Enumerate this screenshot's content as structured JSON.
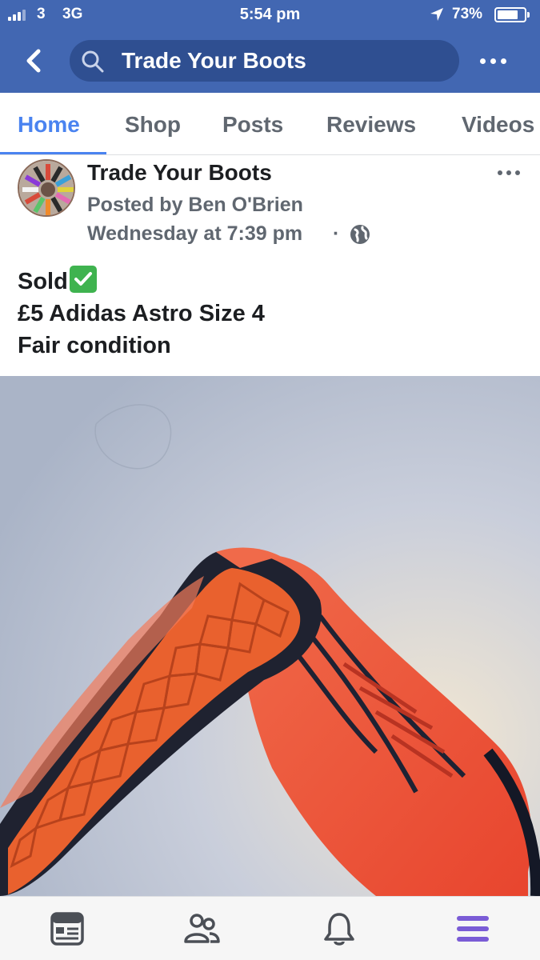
{
  "status_bar": {
    "carrier": "3",
    "network": "3G",
    "time": "5:54 pm",
    "battery_pct": "73%",
    "battery_level": 0.73
  },
  "header": {
    "search_text": "Trade Your Boots",
    "back_icon": "chevron-left-icon",
    "more_icon": "ellipsis-icon"
  },
  "tabs": [
    {
      "label": "Home",
      "active": true
    },
    {
      "label": "Shop",
      "active": false
    },
    {
      "label": "Posts",
      "active": false
    },
    {
      "label": "Reviews",
      "active": false
    },
    {
      "label": "Videos",
      "active": false
    }
  ],
  "post": {
    "page_name": "Trade Your Boots",
    "posted_by": "Posted by Ben O'Brien",
    "time": "Wednesday at 7:39 pm",
    "separator": "·",
    "privacy_icon": "globe-icon",
    "lines": [
      "Sold",
      "£5 Adidas Astro Size 4",
      "Fair condition"
    ],
    "sold_emoji": "check-mark-button-icon"
  },
  "bottom_nav": [
    {
      "icon": "news-feed-icon",
      "active": false
    },
    {
      "icon": "friends-icon",
      "active": false
    },
    {
      "icon": "notifications-bell-icon",
      "active": false
    },
    {
      "icon": "menu-icon",
      "active": true
    }
  ],
  "colors": {
    "brand_blue": "#4267b2",
    "search_bg": "#2f4f91",
    "active_tab": "#4a83f0",
    "menu_purple": "#7a5cd6"
  }
}
